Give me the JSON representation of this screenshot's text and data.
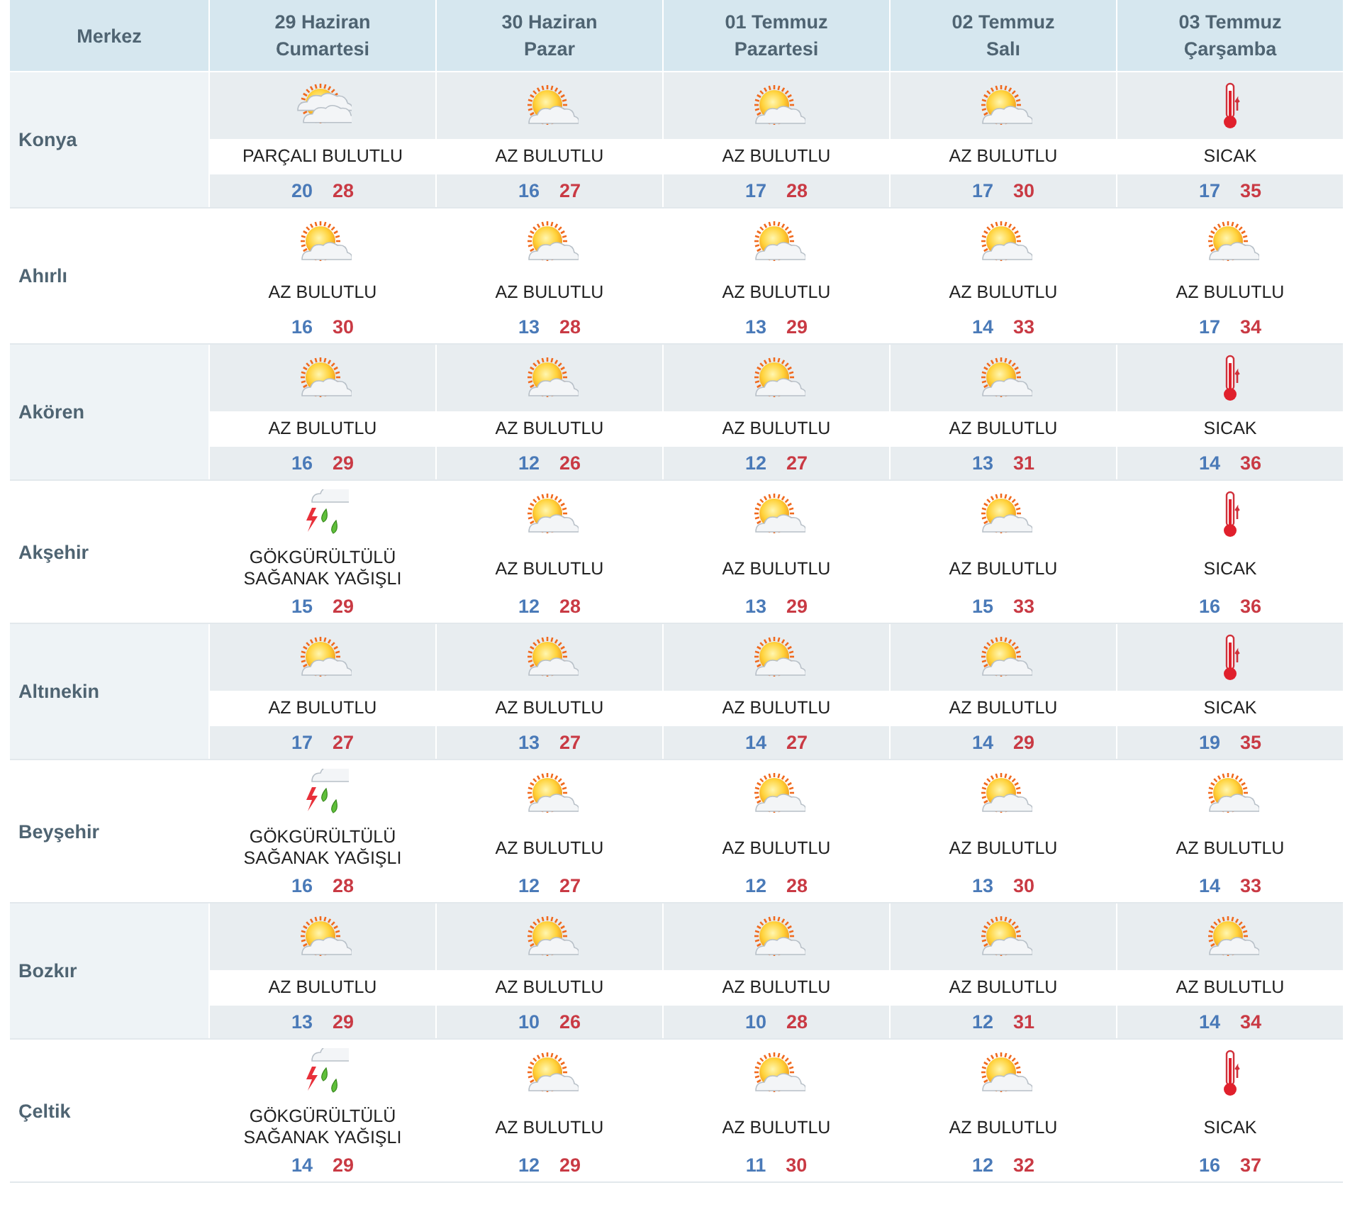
{
  "header": {
    "first_column": "Merkez",
    "days": [
      {
        "date": "29 Haziran",
        "weekday": "Cumartesi"
      },
      {
        "date": "30 Haziran",
        "weekday": "Pazar"
      },
      {
        "date": "01 Temmuz",
        "weekday": "Pazartesi"
      },
      {
        "date": "02 Temmuz",
        "weekday": "Salı"
      },
      {
        "date": "03 Temmuz",
        "weekday": "Çarşamba"
      }
    ]
  },
  "rows": [
    {
      "city": "Konya",
      "forecasts": [
        {
          "kind": "partly_cloudy",
          "condition": "PARÇALI BULUTLU",
          "low": "20",
          "high": "28"
        },
        {
          "kind": "mostly_sunny",
          "condition": "AZ BULUTLU",
          "low": "16",
          "high": "27"
        },
        {
          "kind": "mostly_sunny",
          "condition": "AZ BULUTLU",
          "low": "17",
          "high": "28"
        },
        {
          "kind": "mostly_sunny",
          "condition": "AZ BULUTLU",
          "low": "17",
          "high": "30"
        },
        {
          "kind": "hot",
          "condition": "SICAK",
          "low": "17",
          "high": "35"
        }
      ]
    },
    {
      "city": "Ahırlı",
      "forecasts": [
        {
          "kind": "mostly_sunny",
          "condition": "AZ BULUTLU",
          "low": "16",
          "high": "30"
        },
        {
          "kind": "mostly_sunny",
          "condition": "AZ BULUTLU",
          "low": "13",
          "high": "28"
        },
        {
          "kind": "mostly_sunny",
          "condition": "AZ BULUTLU",
          "low": "13",
          "high": "29"
        },
        {
          "kind": "mostly_sunny",
          "condition": "AZ BULUTLU",
          "low": "14",
          "high": "33"
        },
        {
          "kind": "mostly_sunny",
          "condition": "AZ BULUTLU",
          "low": "17",
          "high": "34"
        }
      ]
    },
    {
      "city": "Akören",
      "forecasts": [
        {
          "kind": "mostly_sunny",
          "condition": "AZ BULUTLU",
          "low": "16",
          "high": "29"
        },
        {
          "kind": "mostly_sunny",
          "condition": "AZ BULUTLU",
          "low": "12",
          "high": "26"
        },
        {
          "kind": "mostly_sunny",
          "condition": "AZ BULUTLU",
          "low": "12",
          "high": "27"
        },
        {
          "kind": "mostly_sunny",
          "condition": "AZ BULUTLU",
          "low": "13",
          "high": "31"
        },
        {
          "kind": "hot",
          "condition": "SICAK",
          "low": "14",
          "high": "36"
        }
      ]
    },
    {
      "city": "Akşehir",
      "forecasts": [
        {
          "kind": "thunderstorm",
          "condition": "GÖKGÜRÜLTÜLÜ SAĞANAK YAĞIŞLI",
          "low": "15",
          "high": "29"
        },
        {
          "kind": "mostly_sunny",
          "condition": "AZ BULUTLU",
          "low": "12",
          "high": "28"
        },
        {
          "kind": "mostly_sunny",
          "condition": "AZ BULUTLU",
          "low": "13",
          "high": "29"
        },
        {
          "kind": "mostly_sunny",
          "condition": "AZ BULUTLU",
          "low": "15",
          "high": "33"
        },
        {
          "kind": "hot",
          "condition": "SICAK",
          "low": "16",
          "high": "36"
        }
      ]
    },
    {
      "city": "Altınekin",
      "forecasts": [
        {
          "kind": "mostly_sunny",
          "condition": "AZ BULUTLU",
          "low": "17",
          "high": "27"
        },
        {
          "kind": "mostly_sunny",
          "condition": "AZ BULUTLU",
          "low": "13",
          "high": "27"
        },
        {
          "kind": "mostly_sunny",
          "condition": "AZ BULUTLU",
          "low": "14",
          "high": "27"
        },
        {
          "kind": "mostly_sunny",
          "condition": "AZ BULUTLU",
          "low": "14",
          "high": "29"
        },
        {
          "kind": "hot",
          "condition": "SICAK",
          "low": "19",
          "high": "35"
        }
      ]
    },
    {
      "city": "Beyşehir",
      "forecasts": [
        {
          "kind": "thunderstorm",
          "condition": "GÖKGÜRÜLTÜLÜ SAĞANAK YAĞIŞLI",
          "low": "16",
          "high": "28"
        },
        {
          "kind": "mostly_sunny",
          "condition": "AZ BULUTLU",
          "low": "12",
          "high": "27"
        },
        {
          "kind": "mostly_sunny",
          "condition": "AZ BULUTLU",
          "low": "12",
          "high": "28"
        },
        {
          "kind": "mostly_sunny",
          "condition": "AZ BULUTLU",
          "low": "13",
          "high": "30"
        },
        {
          "kind": "mostly_sunny",
          "condition": "AZ BULUTLU",
          "low": "14",
          "high": "33"
        }
      ]
    },
    {
      "city": "Bozkır",
      "forecasts": [
        {
          "kind": "mostly_sunny",
          "condition": "AZ BULUTLU",
          "low": "13",
          "high": "29"
        },
        {
          "kind": "mostly_sunny",
          "condition": "AZ BULUTLU",
          "low": "10",
          "high": "26"
        },
        {
          "kind": "mostly_sunny",
          "condition": "AZ BULUTLU",
          "low": "10",
          "high": "28"
        },
        {
          "kind": "mostly_sunny",
          "condition": "AZ BULUTLU",
          "low": "12",
          "high": "31"
        },
        {
          "kind": "mostly_sunny",
          "condition": "AZ BULUTLU",
          "low": "14",
          "high": "34"
        }
      ]
    },
    {
      "city": "Çeltik",
      "forecasts": [
        {
          "kind": "thunderstorm",
          "condition": "GÖKGÜRÜLTÜLÜ SAĞANAK YAĞIŞLI",
          "low": "14",
          "high": "29"
        },
        {
          "kind": "mostly_sunny",
          "condition": "AZ BULUTLU",
          "low": "12",
          "high": "29"
        },
        {
          "kind": "mostly_sunny",
          "condition": "AZ BULUTLU",
          "low": "11",
          "high": "30"
        },
        {
          "kind": "mostly_sunny",
          "condition": "AZ BULUTLU",
          "low": "12",
          "high": "32"
        },
        {
          "kind": "hot",
          "condition": "SICAK",
          "low": "16",
          "high": "37"
        }
      ]
    }
  ]
}
